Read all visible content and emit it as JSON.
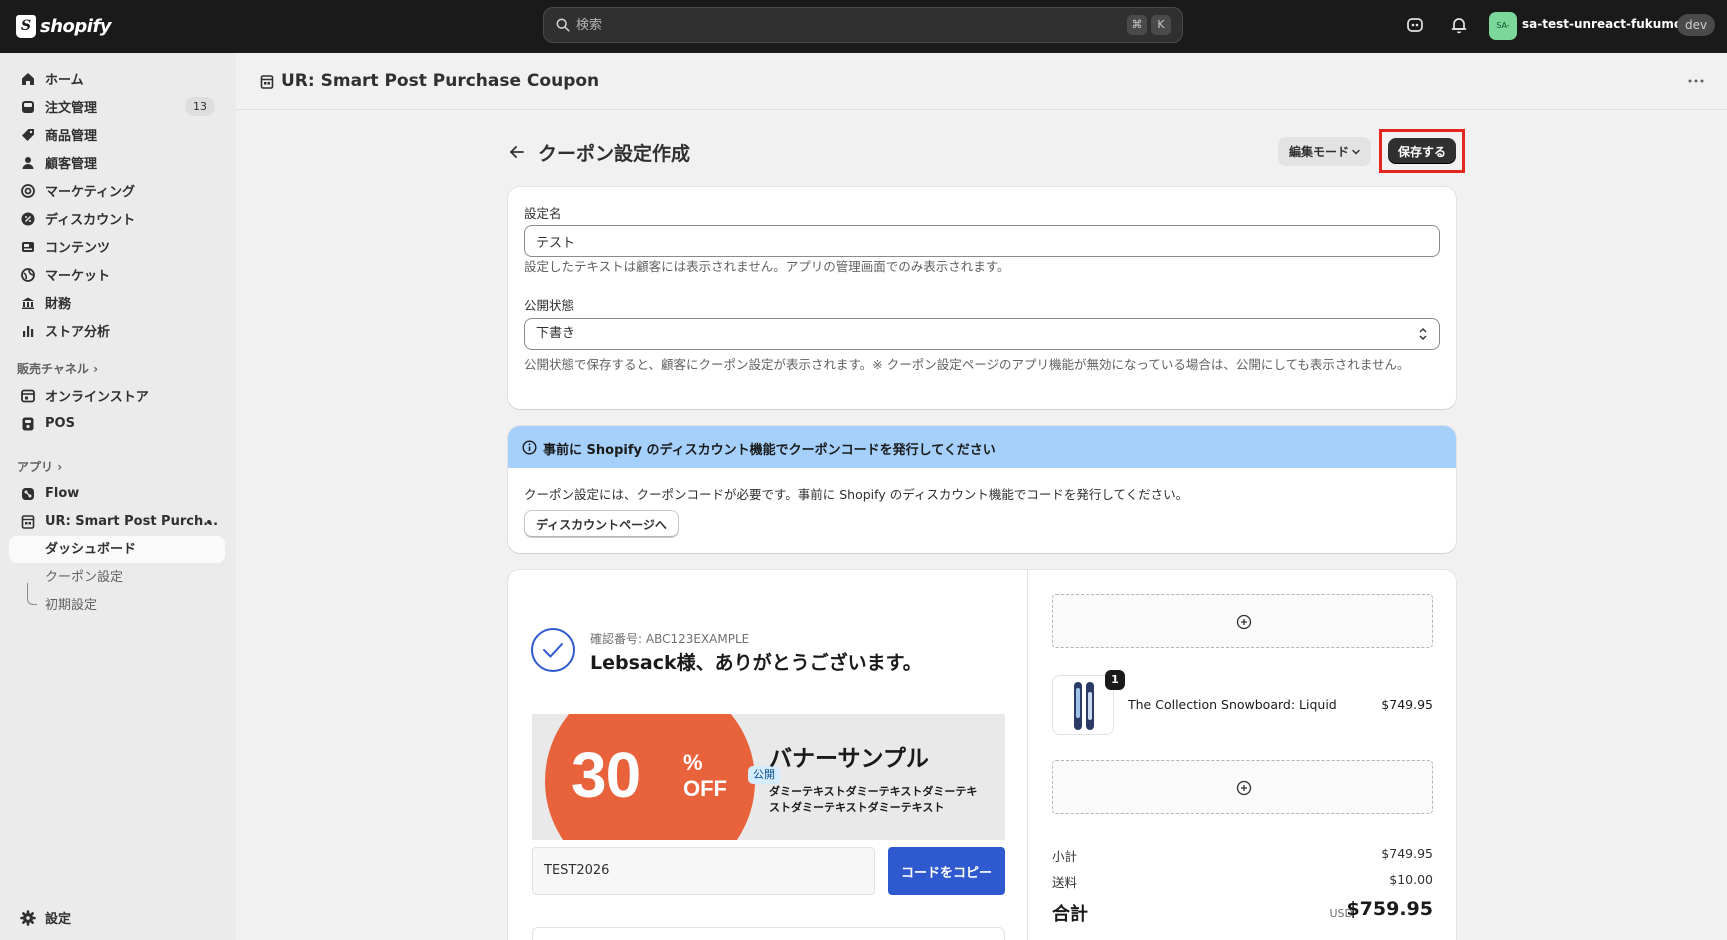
{
  "topbar": {
    "logo_text": "shopify",
    "search_placeholder": "検索",
    "shortcut_cmd": "⌘",
    "shortcut_key": "K",
    "store_avatar": "SA-",
    "store_name": "sa-test-unreact-fukumoto",
    "store_badge": "dev"
  },
  "sidebar": {
    "items": [
      {
        "label": "ホーム",
        "icon": "home-icon"
      },
      {
        "label": "注文管理",
        "icon": "inbox-icon",
        "count": "13"
      },
      {
        "label": "商品管理",
        "icon": "tag-icon"
      },
      {
        "label": "顧客管理",
        "icon": "person-icon"
      },
      {
        "label": "マーケティング",
        "icon": "target-icon"
      },
      {
        "label": "ディスカウント",
        "icon": "discount-icon"
      },
      {
        "label": "コンテンツ",
        "icon": "content-icon"
      },
      {
        "label": "マーケット",
        "icon": "globe-icon"
      },
      {
        "label": "財務",
        "icon": "bank-icon"
      },
      {
        "label": "ストア分析",
        "icon": "chart-icon"
      }
    ],
    "sales_channels_label": "販売チャネル",
    "channels": [
      {
        "label": "オンラインストア",
        "icon": "store-icon"
      },
      {
        "label": "POS",
        "icon": "pos-icon"
      }
    ],
    "apps_label": "アプリ",
    "apps": [
      {
        "label": "Flow",
        "icon": "flow-icon"
      },
      {
        "label": "UR: Smart Post Purch...",
        "icon": "app-icon"
      }
    ],
    "app_sub": [
      "ダッシュボード",
      "クーポン設定",
      "初期設定"
    ],
    "settings_label": "設定"
  },
  "app_header": {
    "title": "UR: Smart Post Purchase Coupon"
  },
  "page": {
    "title": "クーポン設定作成",
    "mode_button": "編集モード",
    "save_button": "保存する"
  },
  "form": {
    "name_label": "設定名",
    "name_value": "テスト",
    "name_help": "設定したテキストは顧客には表示されません。アプリの管理画面でのみ表示されます。",
    "status_label": "公開状態",
    "status_value": "下書き",
    "status_help": "公開状態で保存すると、顧客にクーポン設定が表示されます。※ クーポン設定ページのアプリ機能が無効になっている場合は、公開にしても表示されません。"
  },
  "notice": {
    "title": "事前に Shopify のディスカウント機能でクーポンコードを発行してください",
    "body": "クーポン設定には、クーポンコードが必要です。事前に Shopify のディスカウント機能でコードを発行してください。",
    "button": "ディスカウントページへ"
  },
  "preview": {
    "confirmation": "確認番号: ABC123EXAMPLE",
    "thanks": "Lebsack様、ありがとうございます。",
    "banner": {
      "number": "30",
      "percent": "%",
      "off": "OFF",
      "badge": "公開",
      "title": "バナーサンプル",
      "body": "ダミーテキストダミーテキストダミーテキストダミーテキストダミーテキスト"
    },
    "coupon_code": "TEST2026",
    "copy_button": "コードをコピー",
    "product": {
      "qty": "1",
      "name": "The Collection Snowboard: Liquid",
      "price": "$749.95"
    },
    "summary": {
      "subtotal_label": "小計",
      "subtotal": "$749.95",
      "shipping_label": "送料",
      "shipping": "$10.00",
      "total_label": "合計",
      "currency": "USD",
      "total": "$759.95"
    }
  },
  "colors": {
    "topbar": "#1a1a1a",
    "notice_header": "#a4d0fb",
    "save_highlight": "#e4261c",
    "coupon_orange": "#e8623c",
    "copy_button": "#2f5acf"
  }
}
